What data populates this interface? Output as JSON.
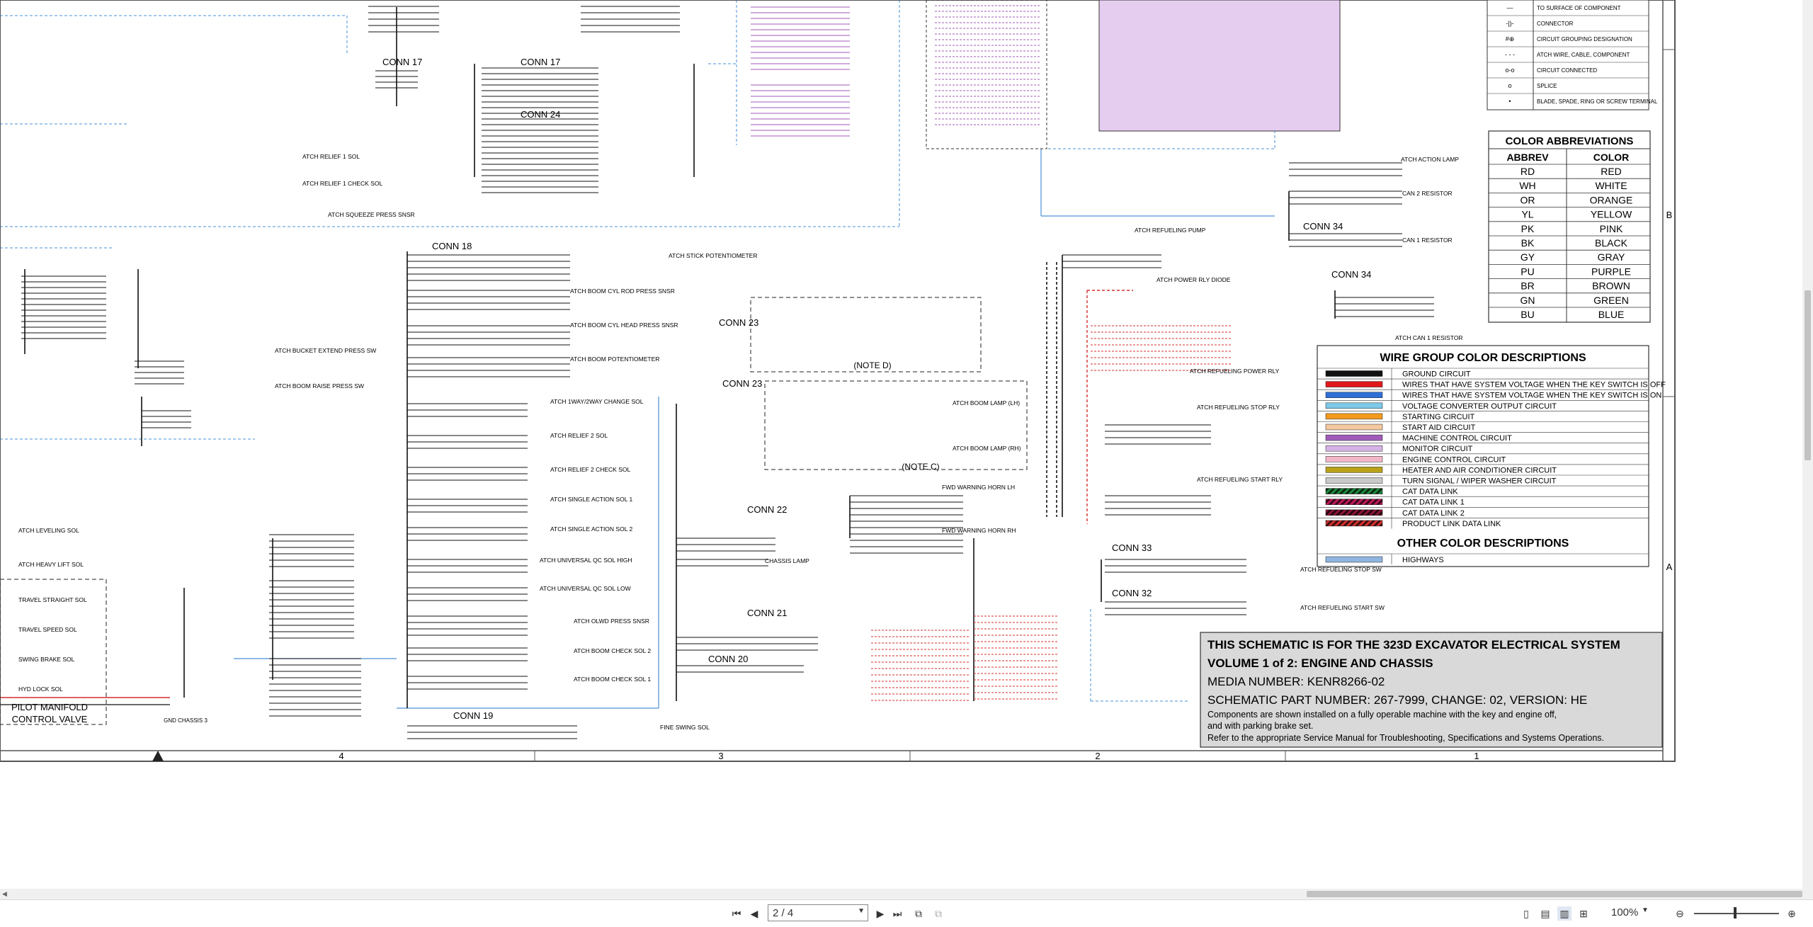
{
  "document": {
    "title_block": {
      "line1": "THIS SCHEMATIC IS FOR THE 323D EXCAVATOR ELECTRICAL SYSTEM",
      "line2": "VOLUME 1 of 2: ENGINE AND CHASSIS",
      "line3": "MEDIA NUMBER: KENR8266-02",
      "line4": "SCHEMATIC PART NUMBER: 267-7999, CHANGE: 02, VERSION: HE",
      "line5": "Components are shown installed on a fully operable machine with the key and engine off,",
      "line6": "and with parking brake set.",
      "line7": "Refer to the appropriate Service Manual for Troubleshooting, Specifications and Systems Operations."
    },
    "zone_numbers": [
      "4",
      "3",
      "2",
      "1"
    ],
    "row_letters": [
      "B",
      "A"
    ],
    "symbol_legend": [
      {
        "label": "TO SURFACE OF COMPONENT"
      },
      {
        "label": "CONNECTOR"
      },
      {
        "label": "CIRCUIT GROUPING DESIGNATION"
      },
      {
        "label": "ATCH WIRE, CABLE, COMPONENT"
      },
      {
        "label": "CIRCUIT CONNECTED"
      },
      {
        "label": "SPLICE"
      },
      {
        "label": "BLADE, SPADE, RING OR SCREW TERMINAL"
      }
    ],
    "color_abbreviations": {
      "title": "COLOR ABBREVIATIONS",
      "col1": "ABBREV",
      "col2": "COLOR",
      "rows": [
        {
          "abbrev": "RD",
          "color": "RED"
        },
        {
          "abbrev": "WH",
          "color": "WHITE"
        },
        {
          "abbrev": "OR",
          "color": "ORANGE"
        },
        {
          "abbrev": "YL",
          "color": "YELLOW"
        },
        {
          "abbrev": "PK",
          "color": "PINK"
        },
        {
          "abbrev": "BK",
          "color": "BLACK"
        },
        {
          "abbrev": "GY",
          "color": "GRAY"
        },
        {
          "abbrev": "PU",
          "color": "PURPLE"
        },
        {
          "abbrev": "BR",
          "color": "BROWN"
        },
        {
          "abbrev": "GN",
          "color": "GREEN"
        },
        {
          "abbrev": "BU",
          "color": "BLUE"
        }
      ]
    },
    "wire_group": {
      "title": "WIRE GROUP COLOR DESCRIPTIONS",
      "rows": [
        {
          "label": "GROUND CIRCUIT",
          "swatch": "#111111",
          "style": "solid"
        },
        {
          "label": "WIRES THAT HAVE SYSTEM VOLTAGE WHEN THE KEY SWITCH IS OFF",
          "swatch": "#e0181b",
          "style": "solid"
        },
        {
          "label": "WIRES THAT HAVE SYSTEM VOLTAGE WHEN THE KEY SWITCH IS ON",
          "swatch": "#2f6fd6",
          "style": "solid"
        },
        {
          "label": "VOLTAGE CONVERTER OUTPUT CIRCUIT",
          "swatch": "#7ec8e8",
          "style": "solid"
        },
        {
          "label": "STARTING CIRCUIT",
          "swatch": "#f39a1e",
          "style": "solid"
        },
        {
          "label": "START AID CIRCUIT",
          "swatch": "#f4c9a0",
          "style": "solid"
        },
        {
          "label": "MACHINE CONTROL CIRCUIT",
          "swatch": "#a05ab8",
          "style": "solid"
        },
        {
          "label": "MONITOR CIRCUIT",
          "swatch": "#d6b3e6",
          "style": "solid"
        },
        {
          "label": "ENGINE CONTROL CIRCUIT",
          "swatch": "#f2b7c7",
          "style": "solid"
        },
        {
          "label": "HEATER AND AIR CONDITIONER CIRCUIT",
          "swatch": "#b9a21a",
          "style": "solid"
        },
        {
          "label": "TURN SIGNAL / WIPER WASHER CIRCUIT",
          "swatch": "#c9c9c9",
          "style": "solid"
        },
        {
          "label": "CAT DATA LINK",
          "swatch": "#1d8a3c",
          "style": "hatch"
        },
        {
          "label": "CAT DATA LINK 1",
          "swatch": "#c2185b",
          "style": "hatch"
        },
        {
          "label": "CAT DATA LINK 2",
          "swatch": "#8a1538",
          "style": "hatch"
        },
        {
          "label": "PRODUCT LINK DATA LINK",
          "swatch": "#d32f2f",
          "style": "hatch"
        }
      ],
      "other_title": "OTHER COLOR DESCRIPTIONS",
      "other_rows": [
        {
          "label": "HIGHWAYS",
          "swatch": "#8fb4e0"
        }
      ]
    },
    "callouts": {
      "note_d": "(NOTE D)",
      "note_c": "(NOTE C)",
      "pilot_manifold": "PILOT MANIFOLD",
      "control_valve": "CONTROL VALVE",
      "gnd_chassis": "GND CHASSIS 3"
    },
    "connectors": [
      {
        "label": "CONN 17"
      },
      {
        "label": "CONN 17"
      },
      {
        "label": "CONN 24"
      },
      {
        "label": "CONN 18"
      },
      {
        "label": "CONN 23"
      },
      {
        "label": "CONN 23"
      },
      {
        "label": "CONN 22"
      },
      {
        "label": "CONN 21"
      },
      {
        "label": "CONN 20"
      },
      {
        "label": "CONN 19"
      },
      {
        "label": "CONN 34"
      },
      {
        "label": "CONN 34"
      },
      {
        "label": "CONN 33"
      },
      {
        "label": "CONN 32"
      }
    ],
    "components": [
      {
        "label": "ATCH RELIEF 1 SOL"
      },
      {
        "label": "ATCH RELIEF 1 CHECK SOL"
      },
      {
        "label": "ATCH SQUEEZE PRESS SNSR"
      },
      {
        "label": "ATCH STICK POTENTIOMETER"
      },
      {
        "label": "ATCH BOOM CYL ROD PRESS SNSR"
      },
      {
        "label": "ATCH BOOM CYL HEAD PRESS SNSR"
      },
      {
        "label": "ATCH BOOM POTENTIOMETER"
      },
      {
        "label": "ATCH BUCKET EXTEND PRESS SW"
      },
      {
        "label": "ATCH BOOM RAISE PRESS SW"
      },
      {
        "label": "ATCH 1WAY/2WAY CHANGE SOL"
      },
      {
        "label": "ATCH RELIEF 2 SOL"
      },
      {
        "label": "ATCH RELIEF 2 CHECK SOL"
      },
      {
        "label": "ATCH SINGLE ACTION SOL 1"
      },
      {
        "label": "ATCH SINGLE ACTION SOL 2"
      },
      {
        "label": "ATCH UNIVERSAL QC SOL HIGH"
      },
      {
        "label": "ATCH UNIVERSAL QC SOL LOW"
      },
      {
        "label": "ATCH OLWD PRESS SNSR"
      },
      {
        "label": "ATCH BOOM CHECK SOL 2"
      },
      {
        "label": "ATCH BOOM CHECK SOL 1"
      },
      {
        "label": "ATCH LEVELING SOL"
      },
      {
        "label": "ATCH HEAVY LIFT SOL"
      },
      {
        "label": "TRAVEL STRAIGHT SOL"
      },
      {
        "label": "TRAVEL SPEED SOL"
      },
      {
        "label": "SWING BRAKE SOL"
      },
      {
        "label": "HYD LOCK SOL"
      },
      {
        "label": "ATCH BOOM LAMP (LH)"
      },
      {
        "label": "ATCH BOOM LAMP (RH)"
      },
      {
        "label": "FWD WARNING HORN LH"
      },
      {
        "label": "FWD WARNING HORN RH"
      },
      {
        "label": "CHASSIS LAMP"
      },
      {
        "label": "FINE SWING SOL"
      },
      {
        "label": "ATCH REFUELING PUMP"
      },
      {
        "label": "ATCH POWER RLY DIODE"
      },
      {
        "label": "ATCH REFUELING POWER RLY"
      },
      {
        "label": "ATCH REFUELING STOP RLY"
      },
      {
        "label": "ATCH REFUELING START RLY"
      },
      {
        "label": "ATCH REFUELING STOP SW"
      },
      {
        "label": "ATCH REFUELING START SW"
      },
      {
        "label": "ATCH ACTION LAMP"
      },
      {
        "label": "CAN 2 RESISTOR"
      },
      {
        "label": "CAN 1 RESISTOR"
      },
      {
        "label": "ATCH CAN 1 RESISTOR"
      }
    ]
  },
  "toolbar": {
    "page_value": "2 / 4",
    "zoom_value": "100%"
  }
}
